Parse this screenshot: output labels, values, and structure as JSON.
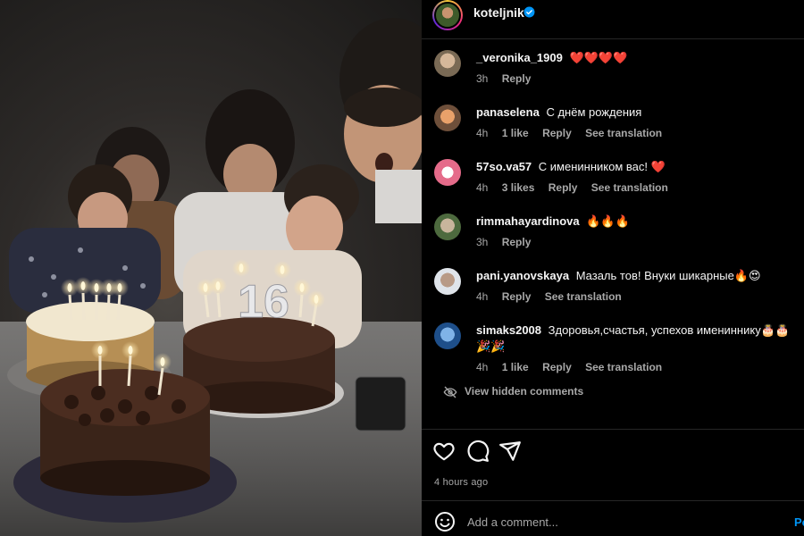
{
  "photo": {
    "cake_number": "16"
  },
  "post_header": {
    "username": "koteljnik",
    "verified": true,
    "avatar_icon": "profile-avatar"
  },
  "comments": [
    {
      "username": "_veronika_1909",
      "text": "❤️❤️❤️❤️",
      "time": "3h",
      "likes": "",
      "reply": "Reply",
      "translation": ""
    },
    {
      "username": "panaselena",
      "text": "С днём рождения",
      "time": "4h",
      "likes": "1 like",
      "reply": "Reply",
      "translation": "See translation"
    },
    {
      "username": "57so.va57",
      "text": "С именинником вас! ❤️",
      "time": "4h",
      "likes": "3 likes",
      "reply": "Reply",
      "translation": "See translation"
    },
    {
      "username": "rimmahayardinova",
      "text": "🔥🔥🔥",
      "time": "3h",
      "likes": "",
      "reply": "Reply",
      "translation": ""
    },
    {
      "username": "pani.yanovskaya",
      "text": "Мазаль тов! Внуки шикарные🔥😍",
      "time": "4h",
      "likes": "",
      "reply": "Reply",
      "translation": "See translation"
    },
    {
      "username": "simaks2008",
      "text": "Здоровья,счастья, успехов имениннику🎂🎂🎉🎉",
      "time": "4h",
      "likes": "1 like",
      "reply": "Reply",
      "translation": "See translation"
    }
  ],
  "hidden_comments": "View hidden comments",
  "actions": {
    "like_icon": "heart-icon",
    "comment_icon": "comment-icon",
    "share_icon": "share-icon"
  },
  "time_ago": "4 hours ago",
  "add_comment": {
    "placeholder": "Add a comment...",
    "post_label": "Post"
  },
  "colors": {
    "background": "#000000",
    "muted_text": "#a8a8a8",
    "link_blue": "#0095f6",
    "verified_blue": "#0095f6"
  }
}
